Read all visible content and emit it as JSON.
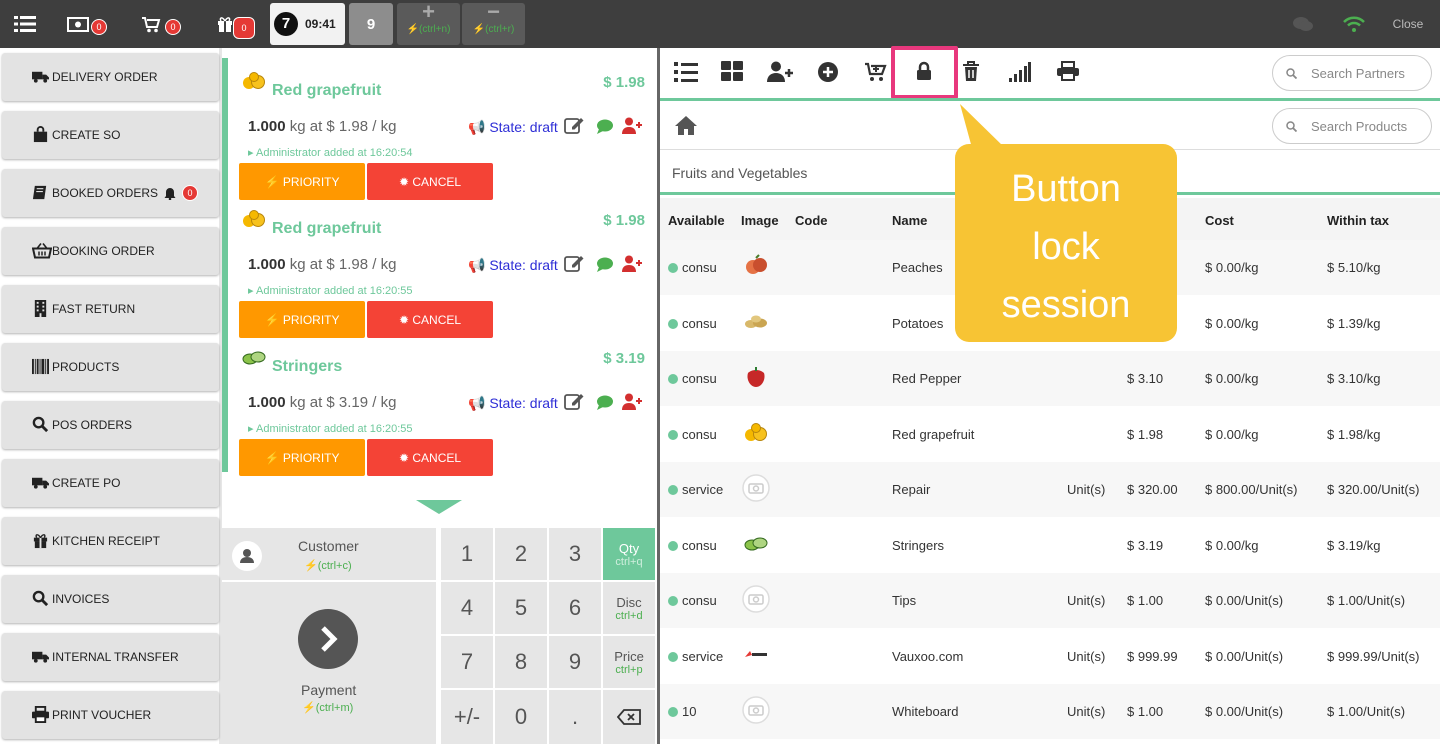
{
  "topbar": {
    "cash_badge": "0",
    "cart_badge": "0",
    "gift_badge": "0",
    "session_number": "7",
    "time": "09:41",
    "order_tab": "9",
    "add_shortcut": "(ctrl+n)",
    "remove_shortcut": "(ctrl+r)",
    "close_label": "Close",
    "colors": {
      "bar": "#3e3e3e",
      "wifi": "#4caf50",
      "badge": "#e53935"
    }
  },
  "left_buttons": [
    {
      "label": "DELIVERY ORDER",
      "icon": "truck-icon"
    },
    {
      "label": "CREATE SO",
      "icon": "bag-icon"
    },
    {
      "label": "BOOKED ORDERS",
      "icon": "book-icon",
      "badge": "0"
    },
    {
      "label": "BOOKING ORDER",
      "icon": "basket-icon"
    },
    {
      "label": "FAST RETURN",
      "icon": "building-icon"
    },
    {
      "label": "PRODUCTS",
      "icon": "barcode-icon"
    },
    {
      "label": "POS ORDERS",
      "icon": "search-icon"
    },
    {
      "label": "CREATE PO",
      "icon": "truck-icon"
    },
    {
      "label": "KITCHEN RECEIPT",
      "icon": "gift-icon"
    },
    {
      "label": "INVOICES",
      "icon": "search-icon"
    },
    {
      "label": "INTERNAL TRANSFER",
      "icon": "truck-icon"
    },
    {
      "label": "PRINT VOUCHER",
      "icon": "print-icon"
    }
  ],
  "order_lines": [
    {
      "name": "Red grapefruit",
      "price": "$ 1.98",
      "qty": "1.000",
      "unit_text": "kg at $ 1.98 / kg",
      "state": "State: draft",
      "added": "Administrator added at 16:20:54",
      "priority": "PRIORITY",
      "cancel": "CANCEL"
    },
    {
      "name": "Red grapefruit",
      "price": "$ 1.98",
      "qty": "1.000",
      "unit_text": "kg at $ 1.98 / kg",
      "state": "State: draft",
      "added": "Administrator added at 16:20:55",
      "priority": "PRIORITY",
      "cancel": "CANCEL"
    },
    {
      "name": "Stringers",
      "price": "$ 3.19",
      "qty": "1.000",
      "unit_text": "kg at $ 3.19 / kg",
      "state": "State: draft",
      "added": "Administrator added at 16:20:55",
      "priority": "PRIORITY",
      "cancel": "CANCEL"
    }
  ],
  "pad": {
    "customer_label": "Customer",
    "customer_shortcut": "(ctrl+c)",
    "payment_label": "Payment",
    "payment_shortcut": "(ctrl+m)",
    "keys": [
      "1",
      "2",
      "3",
      "4",
      "5",
      "6",
      "7",
      "8",
      "9",
      "+/-",
      "0",
      "."
    ],
    "qty_label": "Qty",
    "qty_shortcut": "ctrl+q",
    "disc_label": "Disc",
    "disc_shortcut": "ctrl+d",
    "price_label": "Price",
    "price_shortcut": "ctrl+p"
  },
  "right": {
    "search_partners_placeholder": "Search Partners",
    "search_products_placeholder": "Search Products",
    "category": "Fruits and Vegetables",
    "headers": {
      "available": "Available",
      "image": "Image",
      "code": "Code",
      "name": "Name",
      "cost": "Cost",
      "within_tax": "Within tax"
    },
    "rows": [
      {
        "available": "consu",
        "name": "Peaches",
        "uom": "",
        "price": "",
        "cost": "$ 0.00/kg",
        "tax": "$ 5.10/kg",
        "img": "peach"
      },
      {
        "available": "consu",
        "name": "Potatoes",
        "uom": "",
        "price": "",
        "cost": "$ 0.00/kg",
        "tax": "$ 1.39/kg",
        "img": "potato"
      },
      {
        "available": "consu",
        "name": "Red Pepper",
        "uom": "",
        "price": "$ 3.10",
        "cost": "$ 0.00/kg",
        "tax": "$ 3.10/kg",
        "img": "pepper"
      },
      {
        "available": "consu",
        "name": "Red grapefruit",
        "uom": "",
        "price": "$ 1.98",
        "cost": "$ 0.00/kg",
        "tax": "$ 1.98/kg",
        "img": "grapefruit"
      },
      {
        "available": "service",
        "name": "Repair",
        "uom": "Unit(s)",
        "price": "$ 320.00",
        "cost": "$ 800.00/Unit(s)",
        "tax": "$ 320.00/Unit(s)",
        "img": "camera"
      },
      {
        "available": "consu",
        "name": "Stringers",
        "uom": "",
        "price": "$ 3.19",
        "cost": "$ 0.00/kg",
        "tax": "$ 3.19/kg",
        "img": "stringers"
      },
      {
        "available": "consu",
        "name": "Tips",
        "uom": "Unit(s)",
        "price": "$ 1.00",
        "cost": "$ 0.00/Unit(s)",
        "tax": "$ 1.00/Unit(s)",
        "img": "camera"
      },
      {
        "available": "service",
        "name": "Vauxoo.com",
        "uom": "Unit(s)",
        "price": "$ 999.99",
        "cost": "$ 0.00/Unit(s)",
        "tax": "$ 999.99/Unit(s)",
        "img": "logo"
      },
      {
        "available": "10",
        "name": "Whiteboard",
        "uom": "Unit(s)",
        "price": "$ 1.00",
        "cost": "$ 0.00/Unit(s)",
        "tax": "$ 1.00/Unit(s)",
        "img": "camera"
      }
    ]
  },
  "callout": {
    "line1": "Button",
    "line2": "lock",
    "line3": "session",
    "color": "#f7c434"
  }
}
